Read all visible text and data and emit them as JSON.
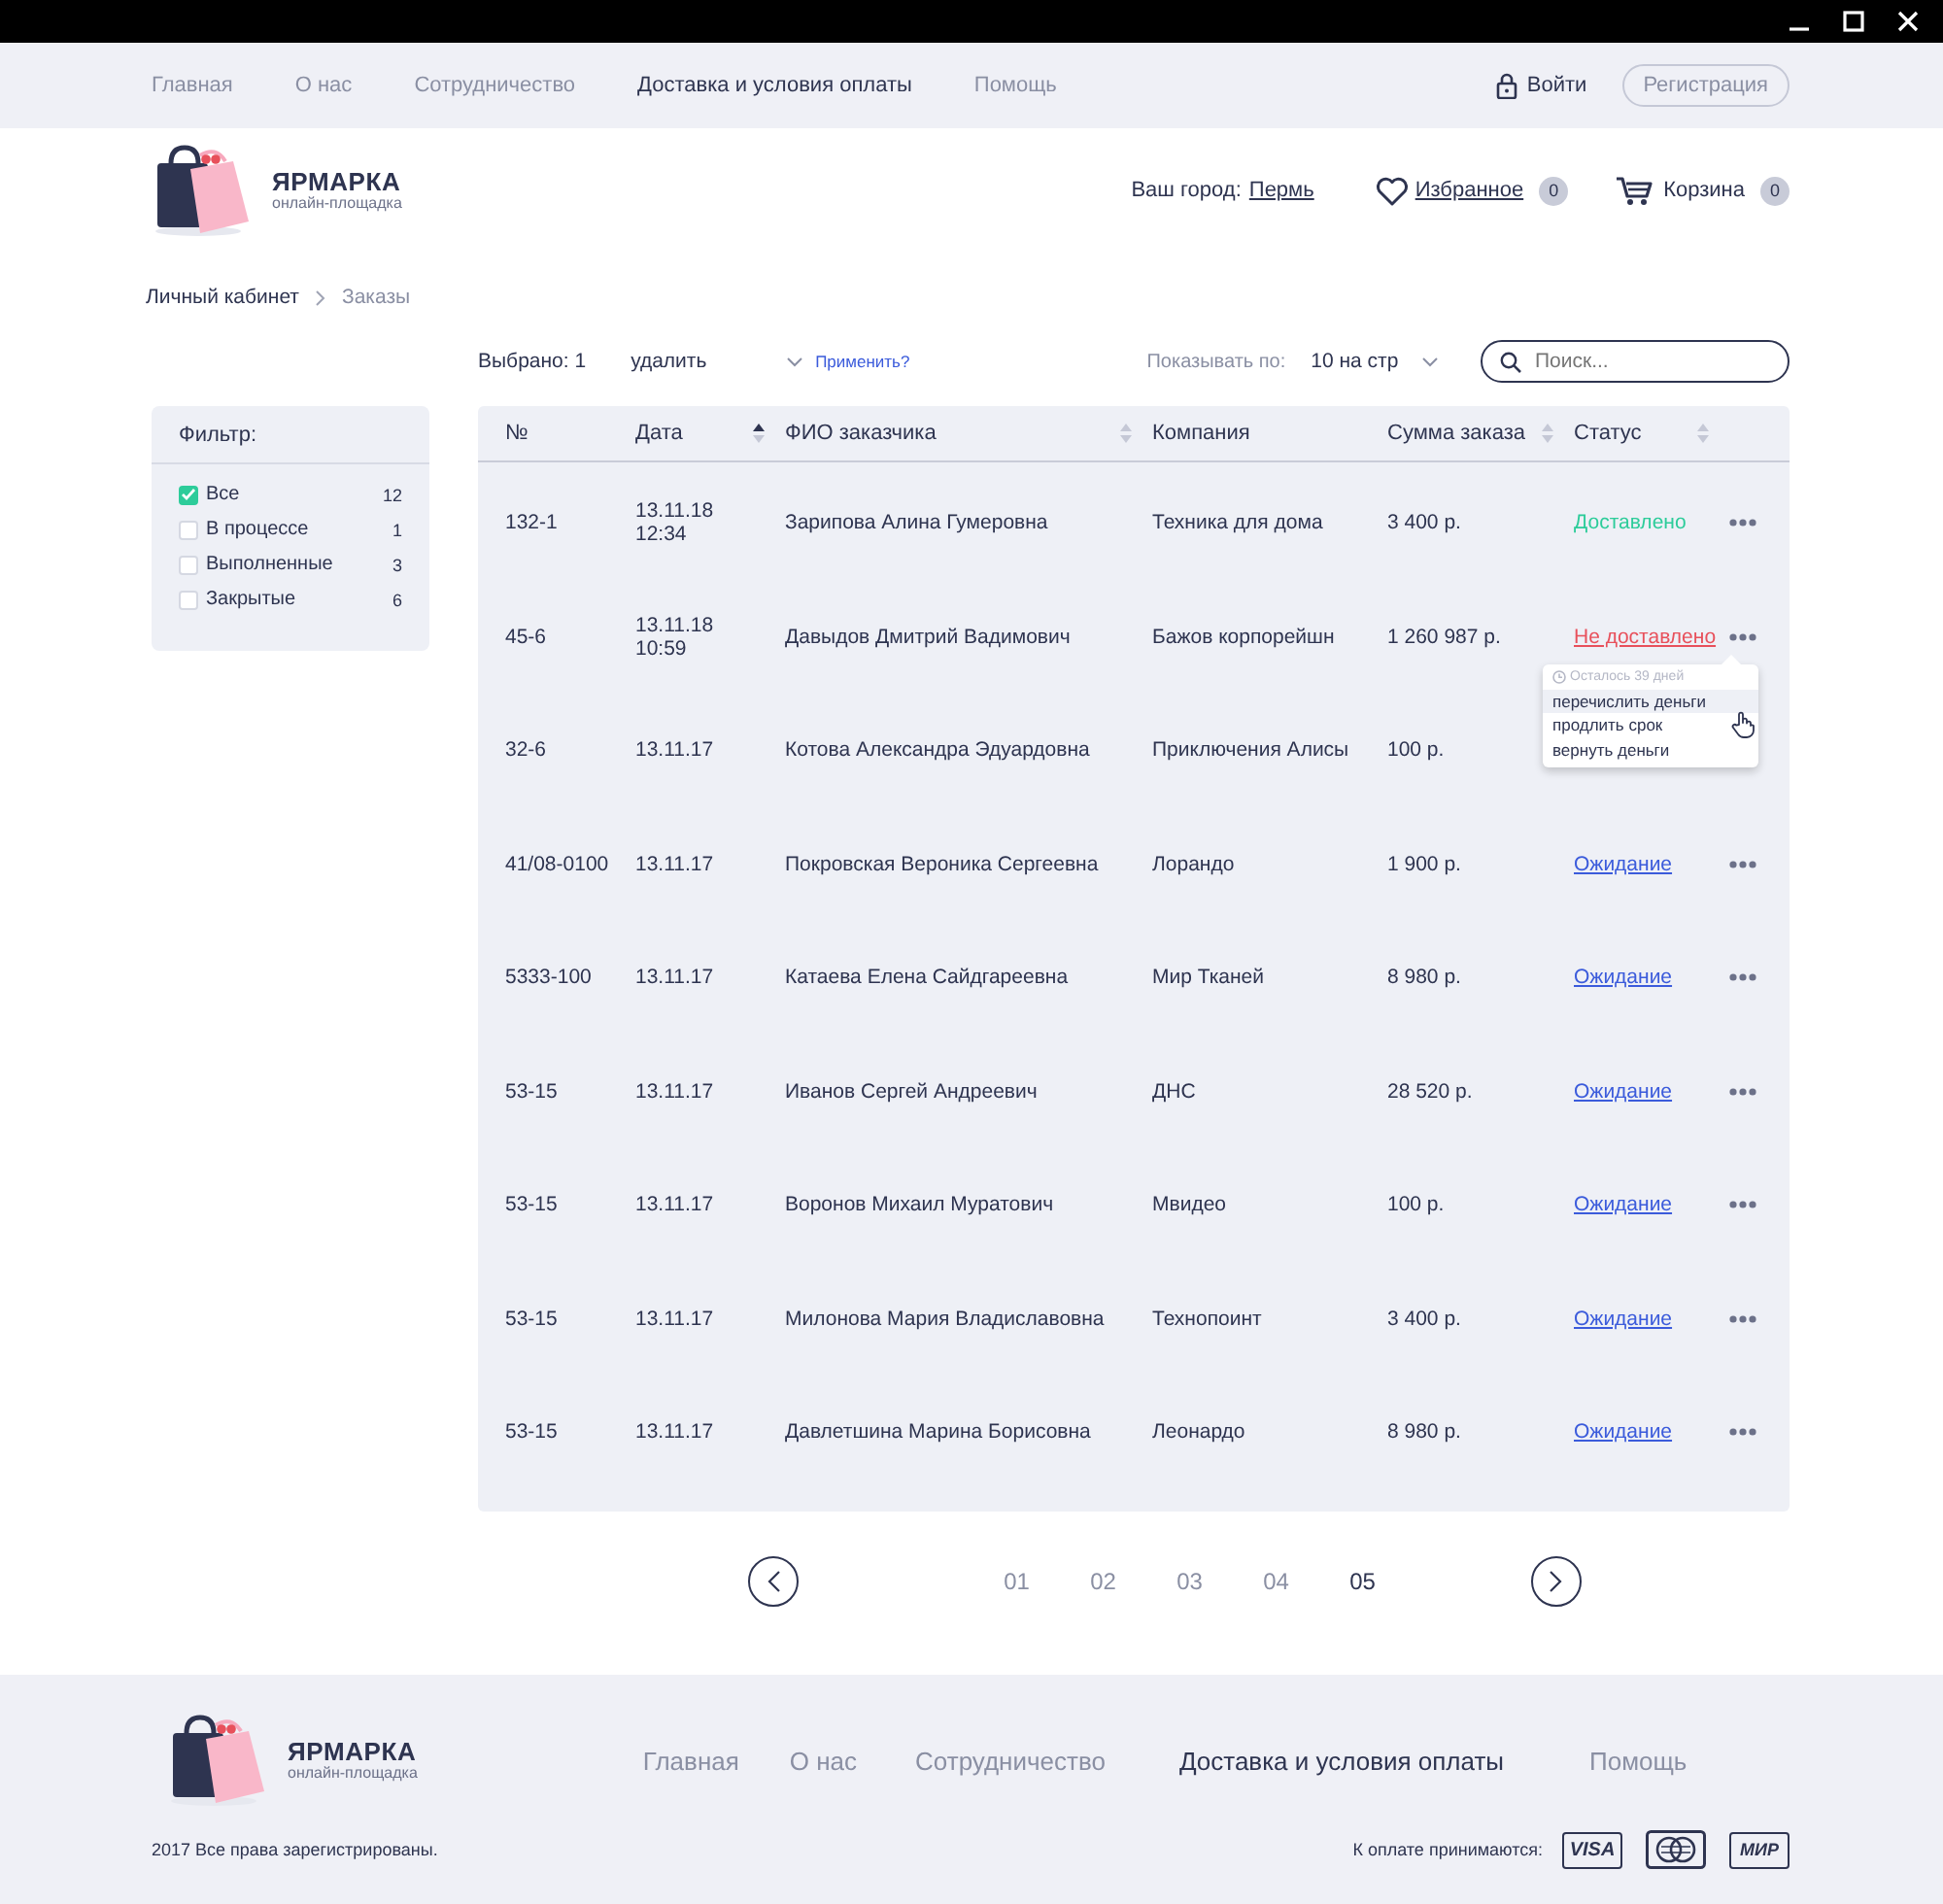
{
  "top_nav": {
    "links": [
      {
        "label": "Главная",
        "selected": false
      },
      {
        "label": "О нас",
        "selected": false
      },
      {
        "label": "Сотрудничество",
        "selected": false
      },
      {
        "label": "Доставка и условия оплаты",
        "selected": true
      },
      {
        "label": "Помощь",
        "selected": false
      }
    ],
    "login": "Войти",
    "register": "Регистрация"
  },
  "header": {
    "logo": {
      "name": "ЯРМАРКА",
      "tagline": "онлайн-площадка"
    },
    "city_label": "Ваш город:",
    "city": "Пермь",
    "favorites": {
      "label": "Избранное",
      "count": "0"
    },
    "cart": {
      "label": "Корзина",
      "count": "0"
    }
  },
  "breadcrumbs": [
    {
      "label": "Личный кабинет",
      "current": false
    },
    {
      "label": "Заказы",
      "current": true
    }
  ],
  "toolbar": {
    "selected_count": "Выбрано: 1",
    "action": "удалить",
    "apply": "Применить?",
    "per_page_label": "Показывать по:",
    "per_page": "10 на стр",
    "search": {
      "placeholder": "Поиск..."
    }
  },
  "filter": {
    "title": "Фильтр:",
    "items": [
      {
        "label": "Все",
        "count": "12",
        "checked": true
      },
      {
        "label": "В процессе",
        "count": "1",
        "checked": false
      },
      {
        "label": "Выполненные",
        "count": "3",
        "checked": false
      },
      {
        "label": "Закрытые",
        "count": "6",
        "checked": false
      }
    ]
  },
  "table": {
    "columns": [
      {
        "label": "№"
      },
      {
        "label": "Дата",
        "sorted": true
      },
      {
        "label": "ФИО заказчика",
        "sorted": false
      },
      {
        "label": "Компания"
      },
      {
        "label": "Сумма заказа",
        "sorted": false
      },
      {
        "label": "Статус",
        "sorted": false
      }
    ],
    "rows": [
      {
        "number": "132-1",
        "date": "13.11.18",
        "time": "12:34",
        "customer": "Зарипова Алина Гумеровна",
        "company": "Техника для дома",
        "sum": "3 400 р.",
        "status": {
          "label": "Доставлено",
          "kind": "delivered"
        }
      },
      {
        "number": "45-6",
        "date": "13.11.18",
        "time": "10:59",
        "customer": "Давыдов Дмитрий Вадимович",
        "company": "Бажов корпорейшн",
        "sum": "1 260 987 р.",
        "status": {
          "label": "Не доставлено",
          "kind": "not_delivered"
        },
        "menu": {
          "note": "Осталось 39 дней",
          "items": [
            {
              "label": "перечислить деньги",
              "selected": true
            },
            {
              "label": "продлить срок",
              "selected": false
            },
            {
              "label": "вернуть деньги",
              "selected": false
            }
          ]
        }
      },
      {
        "number": "32-6",
        "date": "13.11.17",
        "customer": "Котова Александра Эдуардовна",
        "company": "Приключения Алисы",
        "sum": "100 р."
      },
      {
        "number": "41/08-0100",
        "date": "13.11.17",
        "customer": "Покровская Вероника Сергеевна",
        "company": "Лорандо",
        "sum": "1 900 р.",
        "status": {
          "label": "Ожидание",
          "kind": "pending"
        }
      },
      {
        "number": "5333-100",
        "date": "13.11.17",
        "customer": "Катаева Елена Сайдгареевна",
        "company": "Мир Тканей",
        "sum": "8 980 р.",
        "status": {
          "label": "Ожидание",
          "kind": "pending"
        }
      },
      {
        "number": "53-15",
        "date": "13.11.17",
        "customer": "Иванов Сергей Андреевич",
        "company": "ДНС",
        "sum": "28 520 р.",
        "status": {
          "label": "Ожидание",
          "kind": "pending"
        }
      },
      {
        "number": "53-15",
        "date": "13.11.17",
        "customer": "Воронов Михаил Муратович",
        "company": "Мвидео",
        "sum": "100 р.",
        "status": {
          "label": "Ожидание",
          "kind": "pending"
        }
      },
      {
        "number": "53-15",
        "date": "13.11.17",
        "customer": "Милонова Мария Владиславовна",
        "company": "Технопоинт",
        "sum": "3 400 р.",
        "status": {
          "label": "Ожидание",
          "kind": "pending"
        }
      },
      {
        "number": "53-15",
        "date": "13.11.17",
        "customer": "Давлетшина Марина Борисовна",
        "company": "Леонардо",
        "sum": "8 980 р.",
        "status": {
          "label": "Ожидание",
          "kind": "pending"
        }
      }
    ]
  },
  "pagination": {
    "pages": [
      {
        "label": "01",
        "selected": false
      },
      {
        "label": "02",
        "selected": false
      },
      {
        "label": "03",
        "selected": false
      },
      {
        "label": "04",
        "selected": false
      },
      {
        "label": "05",
        "selected": true
      }
    ]
  },
  "footer": {
    "logo": {
      "name": "ЯРМАРКА",
      "tagline": "онлайн-площадка"
    },
    "links": [
      {
        "label": "Главная",
        "selected": false
      },
      {
        "label": "О нас",
        "selected": false
      },
      {
        "label": "Сотрудничество",
        "selected": false
      },
      {
        "label": "Доставка и условия оплаты",
        "selected": true
      },
      {
        "label": "Помощь",
        "selected": false
      }
    ],
    "copyright": "2017 Все права зарегистрированы.",
    "payment_label": "К оплате принимаются:",
    "payment_cards": [
      {
        "kind": "visa",
        "label": "VISA"
      },
      {
        "kind": "mastercard"
      },
      {
        "kind": "mir",
        "label": "МИР"
      }
    ]
  }
}
